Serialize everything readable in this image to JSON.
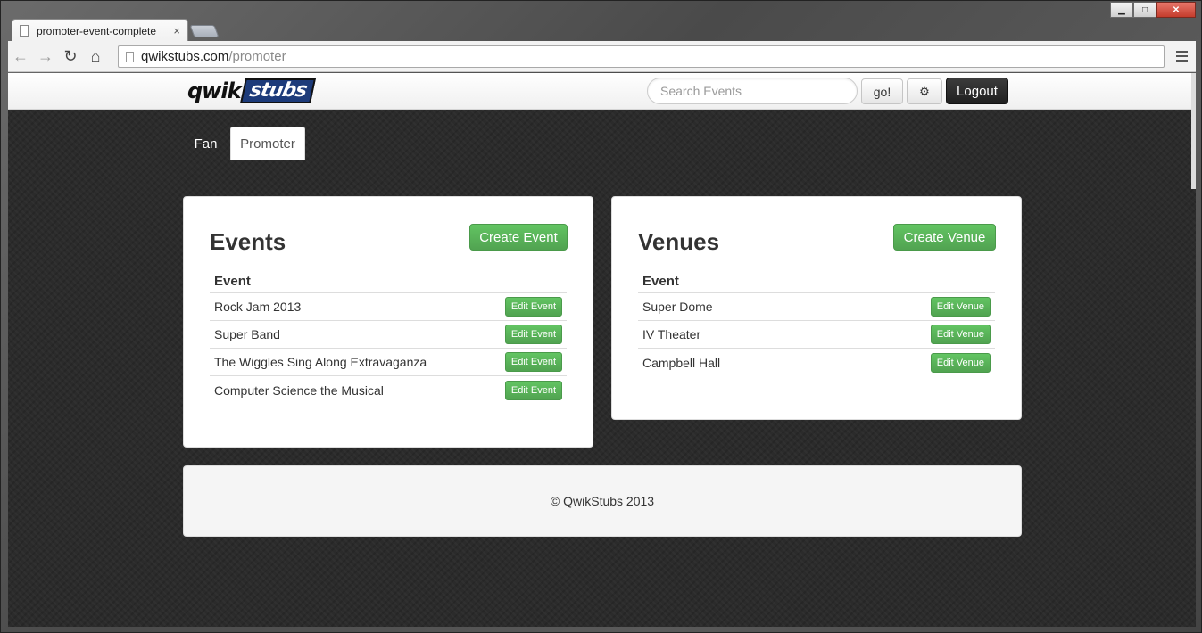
{
  "browser": {
    "tab_title": "promoter-event-complete",
    "tab_close": "×",
    "url_host": "qwikstubs.com",
    "url_path": "/promoter",
    "back_icon": "←",
    "forward_icon": "→",
    "reload_icon": "↻",
    "home_icon": "⌂",
    "minimize": "▁",
    "maximize": "□",
    "close": "✕"
  },
  "navbar": {
    "logo_part1": "qwik",
    "logo_part2": "stubs",
    "search_placeholder": "Search Events",
    "go_label": "go!",
    "gear_icon": "⚙",
    "logout_label": "Logout"
  },
  "tabs": {
    "fan": "Fan",
    "promoter": "Promoter"
  },
  "events": {
    "title": "Events",
    "create_label": "Create Event",
    "column": "Event",
    "rows": [
      {
        "name": "Rock Jam 2013",
        "action": "Edit Event"
      },
      {
        "name": "Super Band",
        "action": "Edit Event"
      },
      {
        "name": "The Wiggles Sing Along Extravaganza",
        "action": "Edit Event"
      },
      {
        "name": "Computer Science the Musical",
        "action": "Edit Event"
      }
    ]
  },
  "venues": {
    "title": "Venues",
    "create_label": "Create Venue",
    "column": "Event",
    "rows": [
      {
        "name": "Super Dome",
        "action": "Edit Venue"
      },
      {
        "name": "IV Theater",
        "action": "Edit Venue"
      },
      {
        "name": "Campbell Hall",
        "action": "Edit Venue"
      }
    ]
  },
  "footer": {
    "text": "© QwikStubs 2013"
  }
}
